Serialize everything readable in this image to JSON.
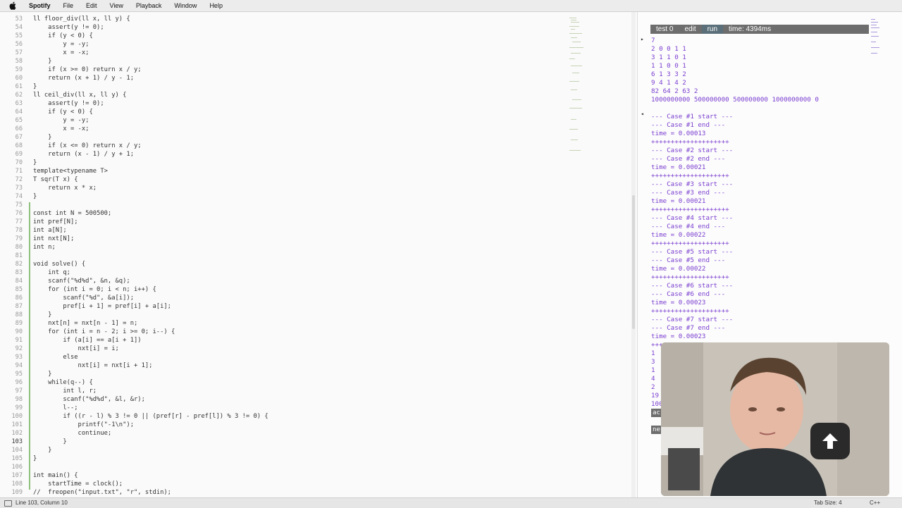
{
  "menubar": {
    "app_name": "Spotify",
    "items": [
      "File",
      "Edit",
      "View",
      "Playback",
      "Window",
      "Help"
    ]
  },
  "editor": {
    "lines": [
      {
        "no": "53",
        "text": "ll floor_div(ll x, ll y) {"
      },
      {
        "no": "54",
        "text": "    assert(y != 0);"
      },
      {
        "no": "55",
        "text": "    if (y < 0) {"
      },
      {
        "no": "56",
        "text": "        y = -y;"
      },
      {
        "no": "57",
        "text": "        x = -x;"
      },
      {
        "no": "58",
        "text": "    }"
      },
      {
        "no": "59",
        "text": "    if (x >= 0) return x / y;"
      },
      {
        "no": "60",
        "text": "    return (x + 1) / y - 1;"
      },
      {
        "no": "61",
        "text": "}"
      },
      {
        "no": "62",
        "text": "ll ceil_div(ll x, ll y) {"
      },
      {
        "no": "63",
        "text": "    assert(y != 0);"
      },
      {
        "no": "64",
        "text": "    if (y < 0) {"
      },
      {
        "no": "65",
        "text": "        y = -y;"
      },
      {
        "no": "66",
        "text": "        x = -x;"
      },
      {
        "no": "67",
        "text": "    }"
      },
      {
        "no": "68",
        "text": "    if (x <= 0) return x / y;"
      },
      {
        "no": "69",
        "text": "    return (x - 1) / y + 1;"
      },
      {
        "no": "70",
        "text": "}"
      },
      {
        "no": "71",
        "text": "template<typename T>"
      },
      {
        "no": "72",
        "text": "T sqr(T x) {"
      },
      {
        "no": "73",
        "text": "    return x * x;"
      },
      {
        "no": "74",
        "text": "}"
      },
      {
        "no": "75",
        "text": ""
      },
      {
        "no": "76",
        "text": "const int N = 500500;"
      },
      {
        "no": "77",
        "text": "int pref[N];"
      },
      {
        "no": "78",
        "text": "int a[N];"
      },
      {
        "no": "79",
        "text": "int nxt[N];"
      },
      {
        "no": "80",
        "text": "int n;"
      },
      {
        "no": "81",
        "text": ""
      },
      {
        "no": "82",
        "text": "void solve() {"
      },
      {
        "no": "83",
        "text": "    int q;"
      },
      {
        "no": "84",
        "text": "    scanf(\"%d%d\", &n, &q);"
      },
      {
        "no": "85",
        "text": "    for (int i = 0; i < n; i++) {"
      },
      {
        "no": "86",
        "text": "        scanf(\"%d\", &a[i]);"
      },
      {
        "no": "87",
        "text": "        pref[i + 1] = pref[i] + a[i];"
      },
      {
        "no": "88",
        "text": "    }"
      },
      {
        "no": "89",
        "text": "    nxt[n] = nxt[n - 1] = n;"
      },
      {
        "no": "90",
        "text": "    for (int i = n - 2; i >= 0; i--) {"
      },
      {
        "no": "91",
        "text": "        if (a[i] == a[i + 1])"
      },
      {
        "no": "92",
        "text": "            nxt[i] = i;"
      },
      {
        "no": "93",
        "text": "        else"
      },
      {
        "no": "94",
        "text": "            nxt[i] = nxt[i + 1];"
      },
      {
        "no": "95",
        "text": "    }"
      },
      {
        "no": "96",
        "text": "    while(q--) {"
      },
      {
        "no": "97",
        "text": "        int l, r;"
      },
      {
        "no": "98",
        "text": "        scanf(\"%d%d\", &l, &r);"
      },
      {
        "no": "99",
        "text": "        l--;"
      },
      {
        "no": "100",
        "text": "        if ((r - l) % 3 != 0 || (pref[r] - pref[l]) % 3 != 0) {"
      },
      {
        "no": "101",
        "text": "            printf(\"-1\\n\");"
      },
      {
        "no": "102",
        "text": "            continue;"
      },
      {
        "no": "103",
        "text": "        }"
      },
      {
        "no": "104",
        "text": "    }"
      },
      {
        "no": "105",
        "text": "}"
      },
      {
        "no": "106",
        "text": ""
      },
      {
        "no": "107",
        "text": "int main() {"
      },
      {
        "no": "108",
        "text": "    startTime = clock();"
      },
      {
        "no": "109",
        "text": "//  freopen(\"input.txt\", \"r\", stdin);"
      }
    ]
  },
  "output": {
    "toolbar": {
      "test_label": "test 0",
      "edit_label": "edit",
      "run_label": "run",
      "time_label": "time: 4394ms"
    },
    "input_lines": [
      "7",
      "2 0 0 1 1",
      "3 1 1 0 1",
      "1 1 0 0 1",
      "6 1 3 3 2",
      "9 4 1 4 2",
      "82 64 2 63 2",
      "1000000000 500000000 500000000 1000000000 0"
    ],
    "log_lines": [
      "--- Case #1 start ---",
      "--- Case #1 end ---",
      "time = 0.00013",
      "++++++++++++++++++++",
      "--- Case #2 start ---",
      "--- Case #2 end ---",
      "time = 0.00021",
      "++++++++++++++++++++",
      "--- Case #3 start ---",
      "--- Case #3 end ---",
      "time = 0.00021",
      "++++++++++++++++++++",
      "--- Case #4 start ---",
      "--- Case #4 end ---",
      "time = 0.00022",
      "++++++++++++++++++++",
      "--- Case #5 start ---",
      "--- Case #5 end ---",
      "time = 0.00022",
      "++++++++++++++++++++",
      "--- Case #6 start ---",
      "--- Case #6 end ---",
      "time = 0.00023",
      "++++++++++++++++++++",
      "--- Case #7 start ---",
      "--- Case #7 end ---",
      "time = 0.00023",
      "++++++++++++++++++++"
    ],
    "result_lines": [
      "1",
      "3",
      "1",
      "4",
      "2",
      "19",
      "100"
    ],
    "result_tag_1": "ac",
    "result_tag_2": "ne"
  },
  "statusbar": {
    "position": "Line 103, Column 10",
    "tab_size": "Tab Size: 4",
    "language": "C++"
  },
  "colors": {
    "keyword": "#a06bb3",
    "number": "#c97bd6",
    "output_text": "#7b3fd0",
    "diff_added": "#8ec07c"
  }
}
